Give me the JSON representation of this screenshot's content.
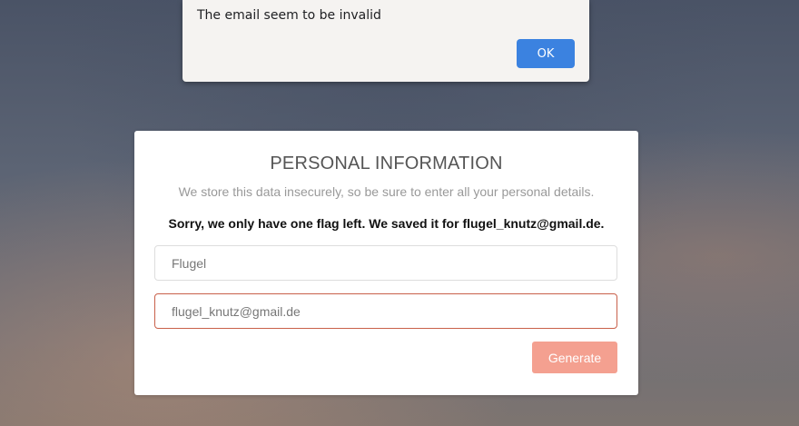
{
  "alert": {
    "message": "The email seem to be invalid",
    "ok_label": "OK"
  },
  "form": {
    "title": "PERSONAL INFORMATION",
    "subtitle": "We store this data insecurely, so be sure to enter all your personal details.",
    "notice": "Sorry, we only have one flag left. We saved it for flugel_knutz@gmail.de.",
    "name_value": "Flugel",
    "email_value": "flugel_knutz@gmail.de",
    "generate_label": "Generate"
  },
  "colors": {
    "alert_button": "#3b82e0",
    "generate_button": "#f4a090",
    "email_error_border": "#c9604a"
  }
}
